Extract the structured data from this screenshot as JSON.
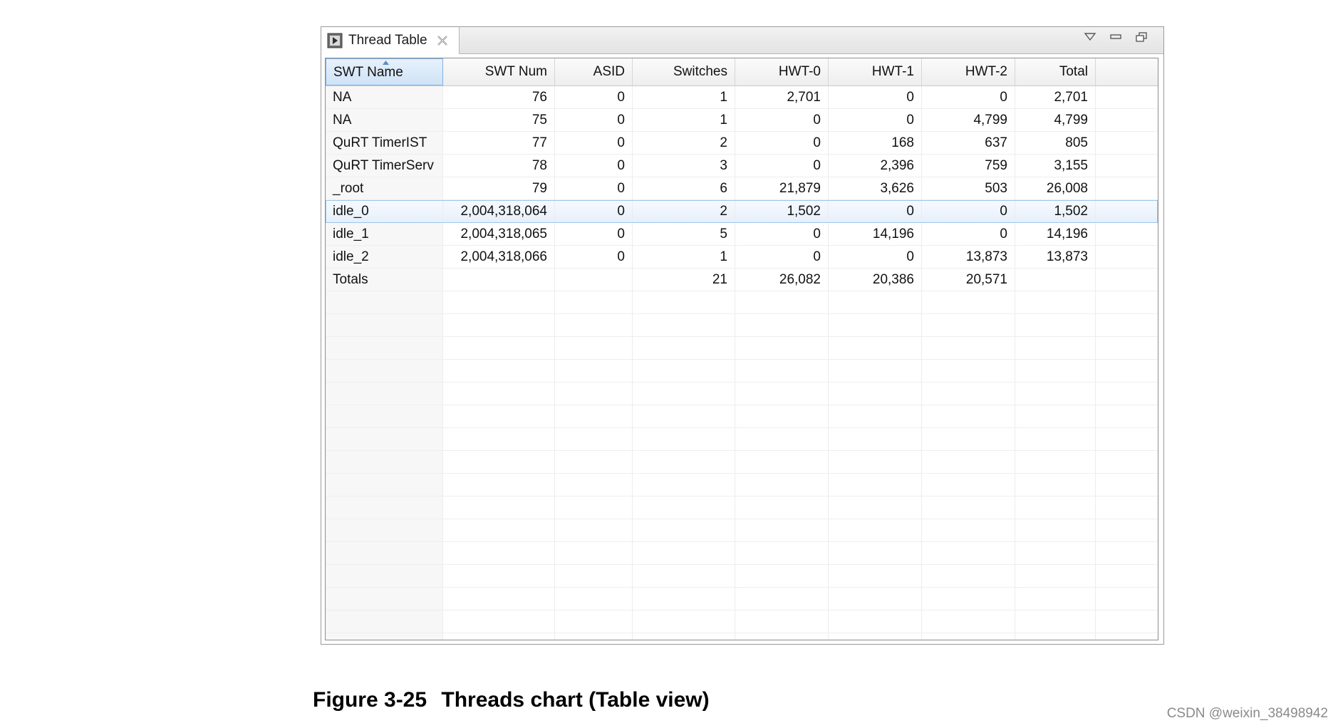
{
  "view": {
    "tab_title": "Thread Table",
    "tab_icon": "thread-view-icon",
    "controls": [
      "view-menu-icon",
      "minimize-icon",
      "restore-icon"
    ]
  },
  "table": {
    "columns": [
      "SWT Name",
      "SWT Num",
      "ASID",
      "Switches",
      "HWT-0",
      "HWT-1",
      "HWT-2",
      "Total"
    ],
    "sorted_column": "SWT Name",
    "rows": [
      [
        "NA",
        "76",
        "0",
        "1",
        "2,701",
        "0",
        "0",
        "2,701"
      ],
      [
        "NA",
        "75",
        "0",
        "1",
        "0",
        "0",
        "4,799",
        "4,799"
      ],
      [
        "QuRT TimerIST",
        "77",
        "0",
        "2",
        "0",
        "168",
        "637",
        "805"
      ],
      [
        "QuRT TimerServ",
        "78",
        "0",
        "3",
        "0",
        "2,396",
        "759",
        "3,155"
      ],
      [
        "_root",
        "79",
        "0",
        "6",
        "21,879",
        "3,626",
        "503",
        "26,008"
      ],
      [
        "idle_0",
        "2,004,318,064",
        "0",
        "2",
        "1,502",
        "0",
        "0",
        "1,502"
      ],
      [
        "idle_1",
        "2,004,318,065",
        "0",
        "5",
        "0",
        "14,196",
        "0",
        "14,196"
      ],
      [
        "idle_2",
        "2,004,318,066",
        "0",
        "1",
        "0",
        "0",
        "13,873",
        "13,873"
      ],
      [
        "Totals",
        "",
        "",
        "21",
        "26,082",
        "20,386",
        "20,571",
        ""
      ]
    ],
    "selected_row_index": 5
  },
  "caption": {
    "number": "Figure 3-25",
    "text": "Threads chart (Table view)"
  },
  "watermark": "CSDN @weixin_38498942"
}
